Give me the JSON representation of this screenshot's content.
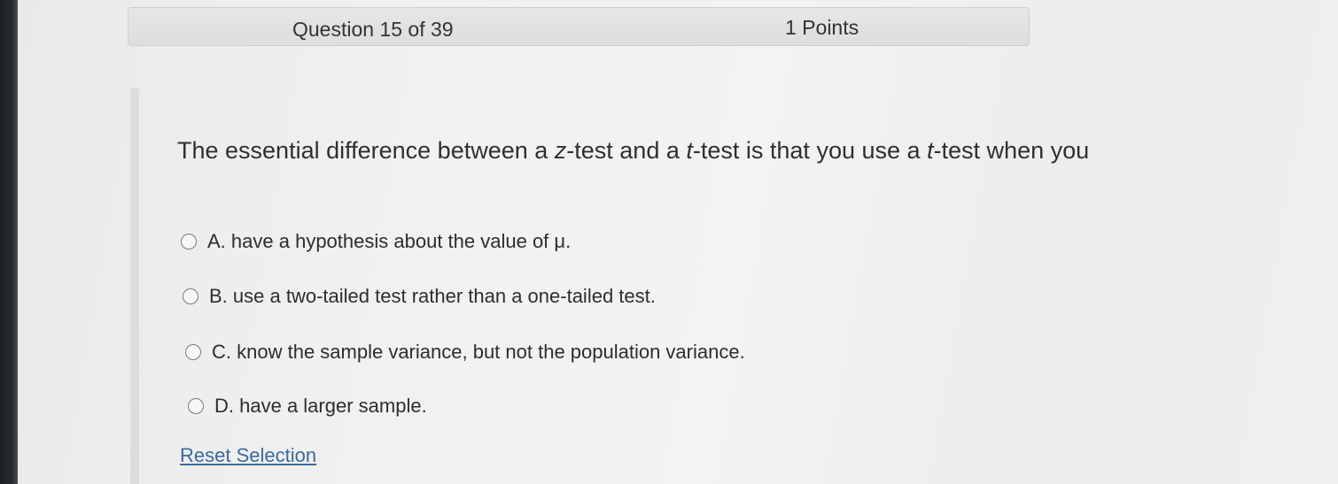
{
  "header": {
    "question_counter": "Question 15 of 39",
    "points": "1 Points"
  },
  "question": {
    "part1": "The essential difference between a ",
    "z": "z",
    "part2": "-test and a ",
    "t1": "t",
    "part3": "-test is that you use a ",
    "t2": "t",
    "part4": "-test when you"
  },
  "options": [
    {
      "letter": "A.",
      "text": "have a hypothesis about the value of μ.",
      "selected": false
    },
    {
      "letter": "B.",
      "text": "use a two-tailed test rather than a one-tailed test.",
      "selected": false
    },
    {
      "letter": "C.",
      "text": "know the sample variance, but not the population variance.",
      "selected": false
    },
    {
      "letter": "D.",
      "text": "have a larger sample.",
      "selected": false
    }
  ],
  "reset_label": "Reset Selection"
}
